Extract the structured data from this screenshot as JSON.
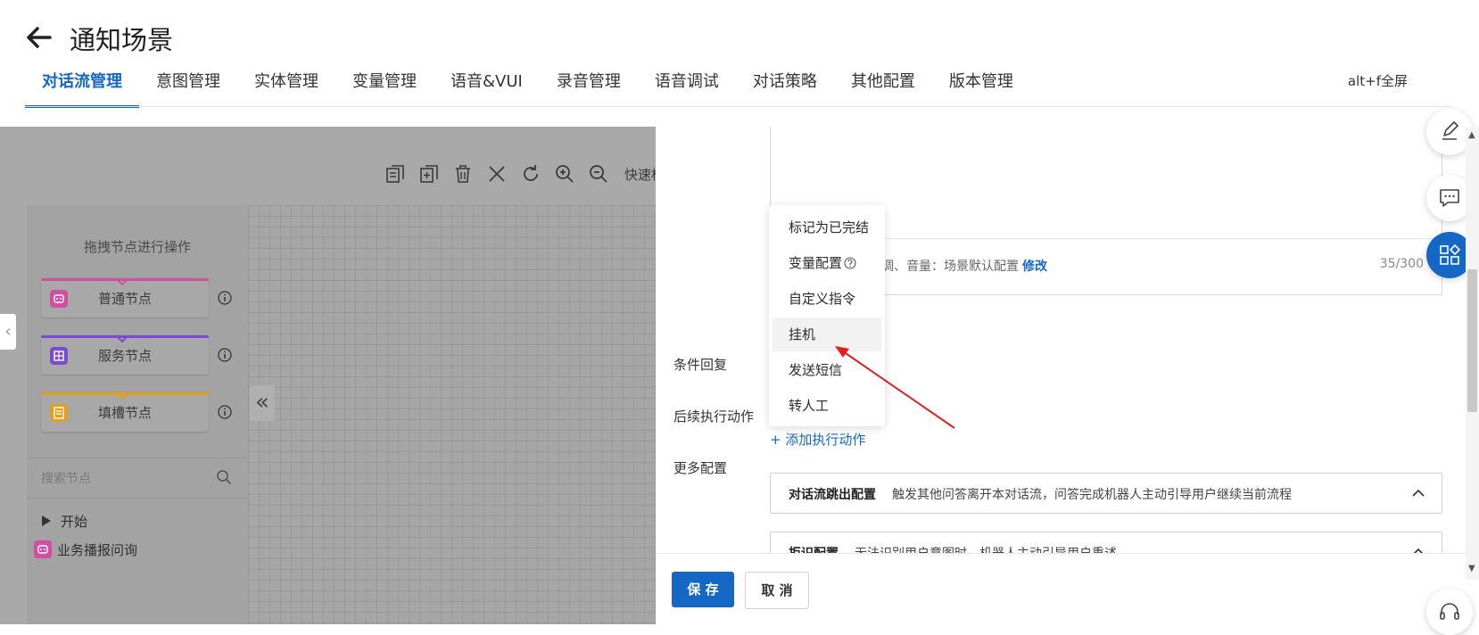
{
  "header": {
    "title": "通知场景",
    "fullscreen_hint": "alt+f全屏",
    "tabs": [
      {
        "label": "对话流管理",
        "active": true
      },
      {
        "label": "意图管理"
      },
      {
        "label": "实体管理"
      },
      {
        "label": "变量管理"
      },
      {
        "label": "语音&VUI"
      },
      {
        "label": "录音管理"
      },
      {
        "label": "语音调试"
      },
      {
        "label": "对话策略"
      },
      {
        "label": "其他配置"
      },
      {
        "label": "版本管理"
      }
    ]
  },
  "canvas": {
    "toolbar_label": "快速框",
    "panel_hint": "拖拽节点进行操作",
    "nodes": [
      {
        "label": "普通节点",
        "color": "#d24fa0"
      },
      {
        "label": "服务节点",
        "color": "#7a4ad0"
      },
      {
        "label": "填槽节点",
        "color": "#e0a020"
      }
    ],
    "search_placeholder": "搜索节点",
    "tree": {
      "start": "开始",
      "item": "业务播报问询"
    }
  },
  "form": {
    "voice_text": "音调、音量：场景默认配置",
    "voice_edit": "修改",
    "char_count": "35/300",
    "labels": {
      "conditional_reply": "条件回复",
      "followup_action": "后续执行动作",
      "more_config": "更多配置"
    },
    "add_action": "+ 添加执行动作",
    "cards": [
      {
        "title": "对话流跳出配置",
        "desc": "触发其他问答离开本对话流，问答完成机器人主动引导用户继续当前流程"
      },
      {
        "title": "拒识配置",
        "desc": "无法识别用户意图时，机器人主动引导用户重述"
      }
    ],
    "save": "保 存",
    "cancel": "取 消"
  },
  "dropdown": {
    "items": [
      {
        "label": "标记为已完结"
      },
      {
        "label": "变量配置"
      },
      {
        "label": "自定义指令"
      },
      {
        "label": "挂机",
        "hover": true
      },
      {
        "label": "发送短信"
      },
      {
        "label": "转人工"
      }
    ]
  },
  "colors": {
    "accent": "#1567c6",
    "annotation_arrow": "#e02020"
  }
}
